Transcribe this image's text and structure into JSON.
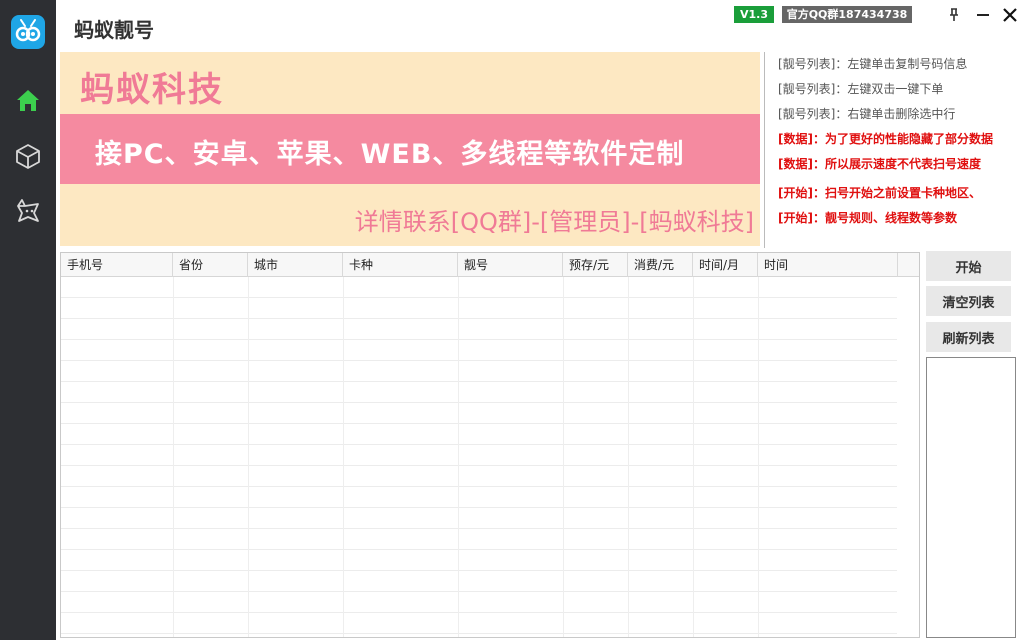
{
  "app": {
    "title": "蚂蚁靓号",
    "version_badge": "V1.3",
    "qq_group": "官方QQ群187434738"
  },
  "sidebar": {
    "items": [
      {
        "icon": "home-icon",
        "active": true
      },
      {
        "icon": "cube-icon",
        "active": false
      },
      {
        "icon": "star-tool-icon",
        "active": false
      }
    ]
  },
  "banner": {
    "line1": "蚂蚁科技",
    "line2": "接PC、安卓、苹果、WEB、多线程等软件定制",
    "line3": "详情联系[QQ群]-[管理员]-[蚂蚁科技]"
  },
  "tips": [
    {
      "text": "[靓号列表]：左键单击复制号码信息",
      "color": "gray"
    },
    {
      "text": "[靓号列表]：左键双击一键下单",
      "color": "gray"
    },
    {
      "text": "[靓号列表]：右键单击删除选中行",
      "color": "gray"
    },
    {
      "text": "[数据]：为了更好的性能隐藏了部分数据",
      "color": "red"
    },
    {
      "text": "[数据]：所以展示速度不代表扫号速度",
      "color": "red"
    },
    {
      "text": "[开始]：扫号开始之前设置卡种地区、",
      "color": "red"
    },
    {
      "text": "[开始]：靓号规则、线程数等参数",
      "color": "red"
    }
  ],
  "table": {
    "columns": [
      "手机号",
      "省份",
      "城市",
      "卡种",
      "靓号",
      "预存/元",
      "消费/元",
      "时间/月",
      "时间"
    ],
    "rows": []
  },
  "buttons": {
    "start": "开始",
    "clear": "清空列表",
    "refresh": "刷新列表"
  },
  "colors": {
    "sidebar_bg": "#2d2f33",
    "logo_bg": "#1fa6e6",
    "active_icon": "#3ccf4e",
    "banner_bg": "#fde8c2",
    "banner_strip": "#f58aa0",
    "banner_text": "#f07a96",
    "version_bg": "#1a9e3a",
    "qq_bg": "#666666",
    "tip_red": "#e01010"
  }
}
